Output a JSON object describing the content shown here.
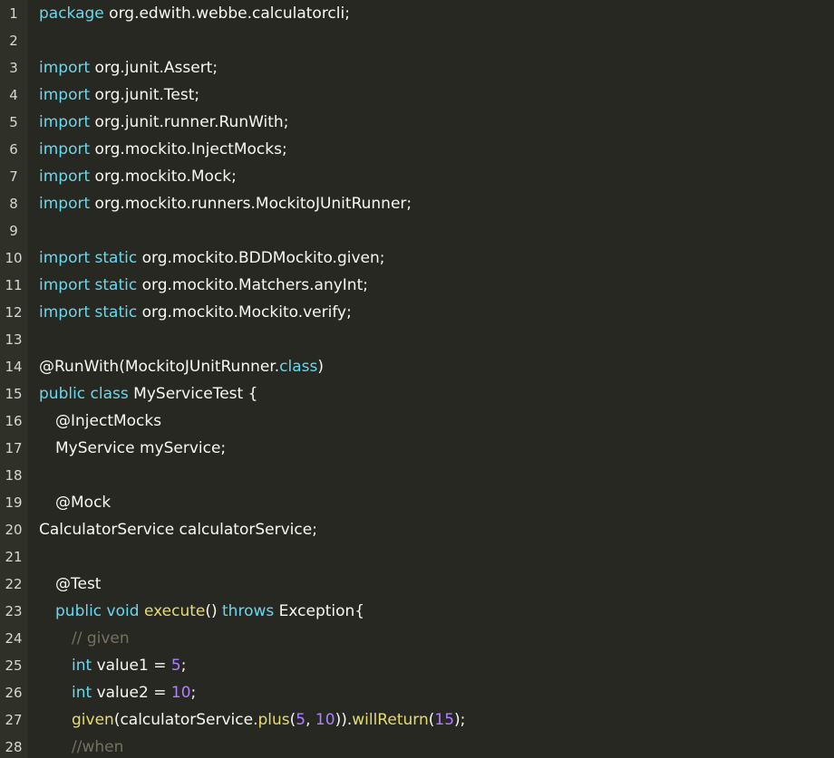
{
  "colors": {
    "background": "#272822",
    "gutter": "#2f3129",
    "keyword": "#66d9ef",
    "function": "#e6db74",
    "number": "#ae81ff",
    "comment": "#75715e",
    "text": "#f8f8f2"
  },
  "lines": [
    {
      "n": "1",
      "indent": 0,
      "tokens": [
        {
          "t": "kw",
          "v": "package"
        },
        {
          "t": "tx",
          "v": " org.edwith.webbe.calculatorcli;"
        }
      ]
    },
    {
      "n": "2",
      "indent": 0,
      "tokens": []
    },
    {
      "n": "3",
      "indent": 0,
      "tokens": [
        {
          "t": "kw",
          "v": "import"
        },
        {
          "t": "tx",
          "v": " org.junit.Assert;"
        }
      ]
    },
    {
      "n": "4",
      "indent": 0,
      "tokens": [
        {
          "t": "kw",
          "v": "import"
        },
        {
          "t": "tx",
          "v": " org.junit.Test;"
        }
      ]
    },
    {
      "n": "5",
      "indent": 0,
      "tokens": [
        {
          "t": "kw",
          "v": "import"
        },
        {
          "t": "tx",
          "v": " org.junit.runner.RunWith;"
        }
      ]
    },
    {
      "n": "6",
      "indent": 0,
      "tokens": [
        {
          "t": "kw",
          "v": "import"
        },
        {
          "t": "tx",
          "v": " org.mockito.InjectMocks;"
        }
      ]
    },
    {
      "n": "7",
      "indent": 0,
      "tokens": [
        {
          "t": "kw",
          "v": "import"
        },
        {
          "t": "tx",
          "v": " org.mockito.Mock;"
        }
      ]
    },
    {
      "n": "8",
      "indent": 0,
      "tokens": [
        {
          "t": "kw",
          "v": "import"
        },
        {
          "t": "tx",
          "v": " org.mockito.runners.MockitoJUnitRunner;"
        }
      ]
    },
    {
      "n": "9",
      "indent": 0,
      "tokens": []
    },
    {
      "n": "10",
      "indent": 0,
      "tokens": [
        {
          "t": "kw",
          "v": "import static"
        },
        {
          "t": "tx",
          "v": " org.mockito.BDDMockito.given;"
        }
      ]
    },
    {
      "n": "11",
      "indent": 0,
      "tokens": [
        {
          "t": "kw",
          "v": "import static"
        },
        {
          "t": "tx",
          "v": " org.mockito.Matchers.anyInt;"
        }
      ]
    },
    {
      "n": "12",
      "indent": 0,
      "tokens": [
        {
          "t": "kw",
          "v": "import static"
        },
        {
          "t": "tx",
          "v": " org.mockito.Mockito.verify;"
        }
      ]
    },
    {
      "n": "13",
      "indent": 0,
      "tokens": []
    },
    {
      "n": "14",
      "indent": 0,
      "tokens": [
        {
          "t": "ann",
          "v": "@RunWith(MockitoJUnitRunner."
        },
        {
          "t": "kw",
          "v": "class"
        },
        {
          "t": "tx",
          "v": ")"
        }
      ]
    },
    {
      "n": "15",
      "indent": 0,
      "tokens": [
        {
          "t": "kw",
          "v": "public class"
        },
        {
          "t": "tx",
          "v": " MyServiceTest {"
        }
      ]
    },
    {
      "n": "16",
      "indent": 1,
      "tokens": [
        {
          "t": "ann",
          "v": "@InjectMocks"
        }
      ]
    },
    {
      "n": "17",
      "indent": 1,
      "tokens": [
        {
          "t": "tx",
          "v": "MyService myService;"
        }
      ]
    },
    {
      "n": "18",
      "indent": 0,
      "tokens": []
    },
    {
      "n": "19",
      "indent": 1,
      "tokens": [
        {
          "t": "ann",
          "v": "@Mock"
        }
      ]
    },
    {
      "n": "20",
      "indent": 0,
      "tokens": [
        {
          "t": "tx",
          "v": "CalculatorService calculatorService;"
        }
      ]
    },
    {
      "n": "21",
      "indent": 0,
      "tokens": []
    },
    {
      "n": "22",
      "indent": 1,
      "tokens": [
        {
          "t": "ann",
          "v": "@Test"
        }
      ]
    },
    {
      "n": "23",
      "indent": 1,
      "tokens": [
        {
          "t": "kw",
          "v": "public void"
        },
        {
          "t": "tx",
          "v": " "
        },
        {
          "t": "fn",
          "v": "execute"
        },
        {
          "t": "tx",
          "v": "() "
        },
        {
          "t": "kw",
          "v": "throws"
        },
        {
          "t": "tx",
          "v": " Exception{"
        }
      ]
    },
    {
      "n": "24",
      "indent": 2,
      "tokens": [
        {
          "t": "cm",
          "v": "// given"
        }
      ]
    },
    {
      "n": "25",
      "indent": 2,
      "tokens": [
        {
          "t": "kw",
          "v": "int"
        },
        {
          "t": "tx",
          "v": " value1 = "
        },
        {
          "t": "num",
          "v": "5"
        },
        {
          "t": "tx",
          "v": ";"
        }
      ]
    },
    {
      "n": "26",
      "indent": 2,
      "tokens": [
        {
          "t": "kw",
          "v": "int"
        },
        {
          "t": "tx",
          "v": " value2 = "
        },
        {
          "t": "num",
          "v": "10"
        },
        {
          "t": "tx",
          "v": ";"
        }
      ]
    },
    {
      "n": "27",
      "indent": 2,
      "tokens": [
        {
          "t": "fn",
          "v": "given"
        },
        {
          "t": "tx",
          "v": "(calculatorService."
        },
        {
          "t": "fn",
          "v": "plus"
        },
        {
          "t": "tx",
          "v": "("
        },
        {
          "t": "num",
          "v": "5"
        },
        {
          "t": "tx",
          "v": ", "
        },
        {
          "t": "num",
          "v": "10"
        },
        {
          "t": "tx",
          "v": "))."
        },
        {
          "t": "fn",
          "v": "willReturn"
        },
        {
          "t": "tx",
          "v": "("
        },
        {
          "t": "num",
          "v": "15"
        },
        {
          "t": "tx",
          "v": ");"
        }
      ]
    },
    {
      "n": "28",
      "indent": 2,
      "tokens": [
        {
          "t": "cm",
          "v": "//when"
        }
      ]
    }
  ]
}
